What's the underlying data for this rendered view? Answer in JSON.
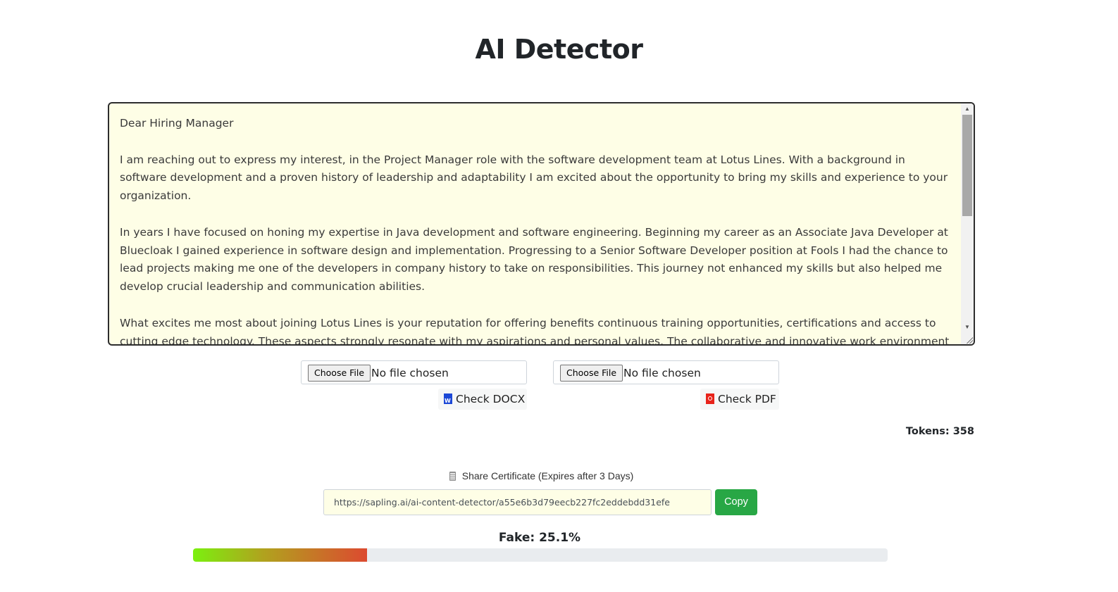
{
  "page": {
    "title": "AI Detector"
  },
  "editor": {
    "paragraphs": [
      "Dear Hiring Manager",
      "I am reaching out to express my interest, in the Project Manager role with the software development team at Lotus Lines. With a background in software development and a proven history of leadership and adaptability I am excited about the opportunity to bring my skills and experience to your organization.",
      "In years I have focused on honing my expertise in Java development and software engineering. Beginning my career as an Associate Java Developer at Bluecloak I gained experience in software design and implementation. Progressing to a Senior Software Developer position at Fools I had the chance to lead projects making me one of the developers in company history to take on responsibilities. This journey not enhanced my skills but also helped me develop crucial leadership and communication abilities.",
      "What excites me most about joining Lotus Lines is your reputation for offering benefits continuous training opportunities, certifications and access to cutting edge technology. These aspects strongly resonate with my aspirations and personal values. The collaborative and innovative work environment that Lotus Lines is known for is particularly appealing to me. I am confident that this setting will provide me with the opportunity to excel and make"
    ]
  },
  "upload": {
    "docx": {
      "choose_label": "Choose File",
      "status": "No file chosen",
      "check_label": "Check DOCX",
      "icon": "word-document-icon",
      "icon_color": "#1c48d6"
    },
    "pdf": {
      "choose_label": "Choose File",
      "status": "No file chosen",
      "check_label": "Check PDF",
      "icon": "pdf-document-icon",
      "icon_color": "#e8231a"
    }
  },
  "tokens": {
    "label": "Tokens: 358"
  },
  "share": {
    "icon": "scroll-icon",
    "label": "Share Certificate (Expires after 3 Days)",
    "url": "https://sapling.ai/ai-content-detector/a55e6b3d79eecb227fc2eddebdd31efe",
    "copy_label": "Copy",
    "copy_color": "#28a745"
  },
  "result": {
    "fake_label": "Fake: 25.1%",
    "fake_fraction": 0.251
  }
}
